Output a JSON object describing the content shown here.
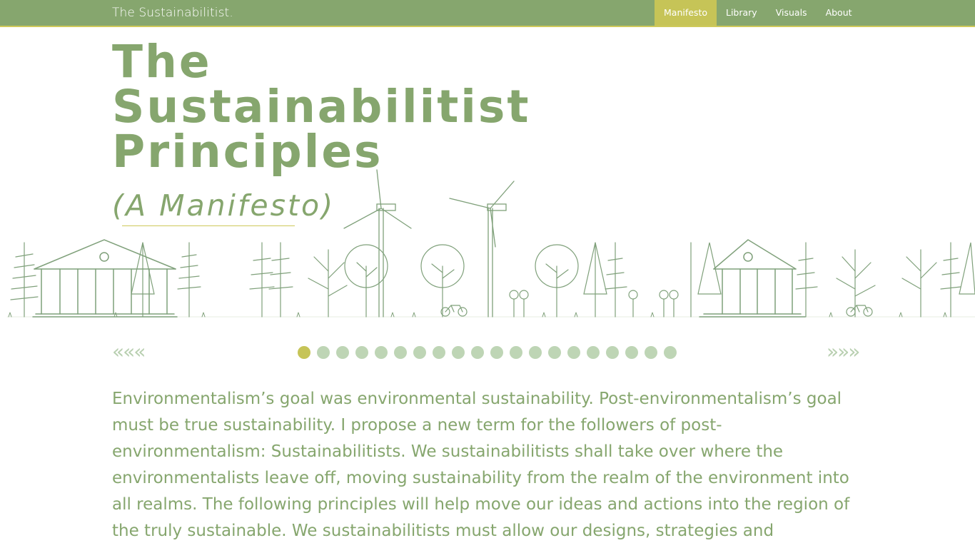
{
  "brand": "The Sustainabilitist.",
  "nav": {
    "items": [
      {
        "label": "Manifesto",
        "active": true
      },
      {
        "label": "Library"
      },
      {
        "label": "Visuals"
      },
      {
        "label": "About"
      }
    ]
  },
  "hero": {
    "title_line1": "The",
    "title_line2": "Sustainabilitist",
    "title_line3": "Principles",
    "subtitle": "(A Manifesto)"
  },
  "pager": {
    "prev": "«««",
    "next": "»»»",
    "total": 20,
    "current": 1
  },
  "body": {
    "text": "Environmentalism’s goal was environmental sustainability. Post-environmentalism’s goal must be true sustainability. I propose a new term for the followers of post-environmentalism: Sustainabilitists. We sustainabilitists shall take over where the environmentalists leave off, moving sustainability from the realm of the environment into all realms. The following principles will help move our ideas and actions into the region of the truly sustainable. We sustainabilitists must allow our designs, strategies and"
  },
  "colors": {
    "green": "#86a66e",
    "accent": "#c6c457",
    "dot": "#bed5b5",
    "illustration": "#7fa07a"
  }
}
